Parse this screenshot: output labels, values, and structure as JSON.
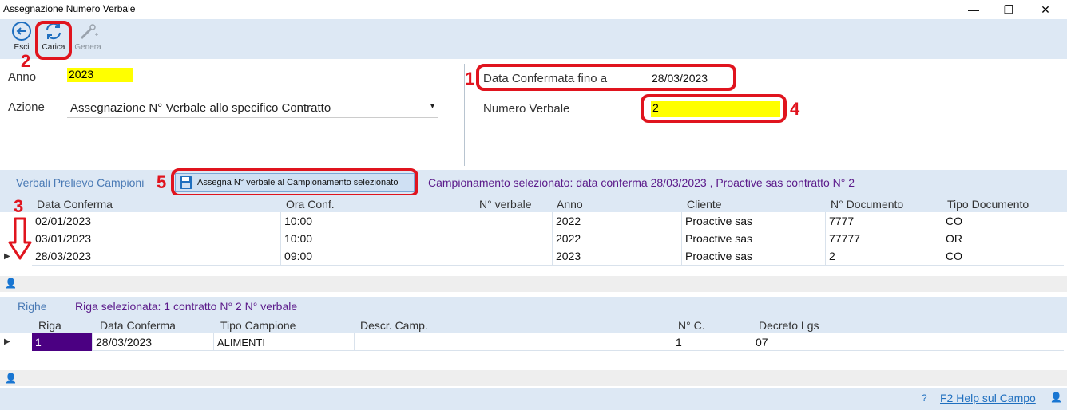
{
  "window": {
    "title": "Assegnazione Numero Verbale",
    "minimize": "—",
    "maximize": "❐",
    "close": "✕"
  },
  "toolbar": {
    "esci_label": "Esci",
    "carica_label": "Carica",
    "genera_label": "Genera"
  },
  "form": {
    "anno_label": "Anno",
    "anno_value": "2023",
    "azione_label": "Azione",
    "azione_value": "Assegnazione N° Verbale allo specifico Contratto",
    "data_conf_label": "Data Confermata fino a",
    "data_conf_value": "28/03/2023",
    "num_verbale_label": "Numero Verbale",
    "num_verbale_value": "2"
  },
  "annotations": {
    "n1": "1",
    "n2": "2",
    "n3": "3",
    "n4": "4",
    "n5": "5"
  },
  "verbali": {
    "section_label": "Verbali Prelievo Campioni",
    "assign_button": "Assegna N° verbale al Campionamento selezionato",
    "selected_info": "Campionamento selezionato: data conferma 28/03/2023 , Proactive sas contratto N° 2",
    "columns": [
      "Data Conferma",
      "Ora Conf.",
      "N° verbale",
      "Anno",
      "Cliente",
      "N° Documento",
      "Tipo Documento"
    ],
    "rows": [
      [
        "02/01/2023",
        "10:00",
        "",
        "2022",
        "Proactive sas",
        "7777",
        "CO"
      ],
      [
        "03/01/2023",
        "10:00",
        "",
        "2022",
        "Proactive sas",
        "77777",
        "OR"
      ],
      [
        "28/03/2023",
        "09:00",
        "",
        "2023",
        "Proactive sas",
        "2",
        "CO"
      ]
    ]
  },
  "righe": {
    "section_label": "Righe",
    "selected_info": "Riga selezionata: 1 contratto N° 2 N° verbale",
    "columns": [
      "Riga",
      "Data Conferma",
      "Tipo Campione",
      "Descr. Camp.",
      "N° C.",
      "Decreto Lgs"
    ],
    "rows": [
      [
        "1",
        "28/03/2023",
        "ALIMENTI",
        "",
        "1",
        "07"
      ]
    ]
  },
  "footer": {
    "help": "F2 Help sul Campo"
  },
  "colors": {
    "accent_red": "#e0141e",
    "highlight_yellow": "#ffff00",
    "band_blue": "#dde8f4",
    "purple": "#5b1a8a",
    "selected_cell": "#4b0082"
  }
}
